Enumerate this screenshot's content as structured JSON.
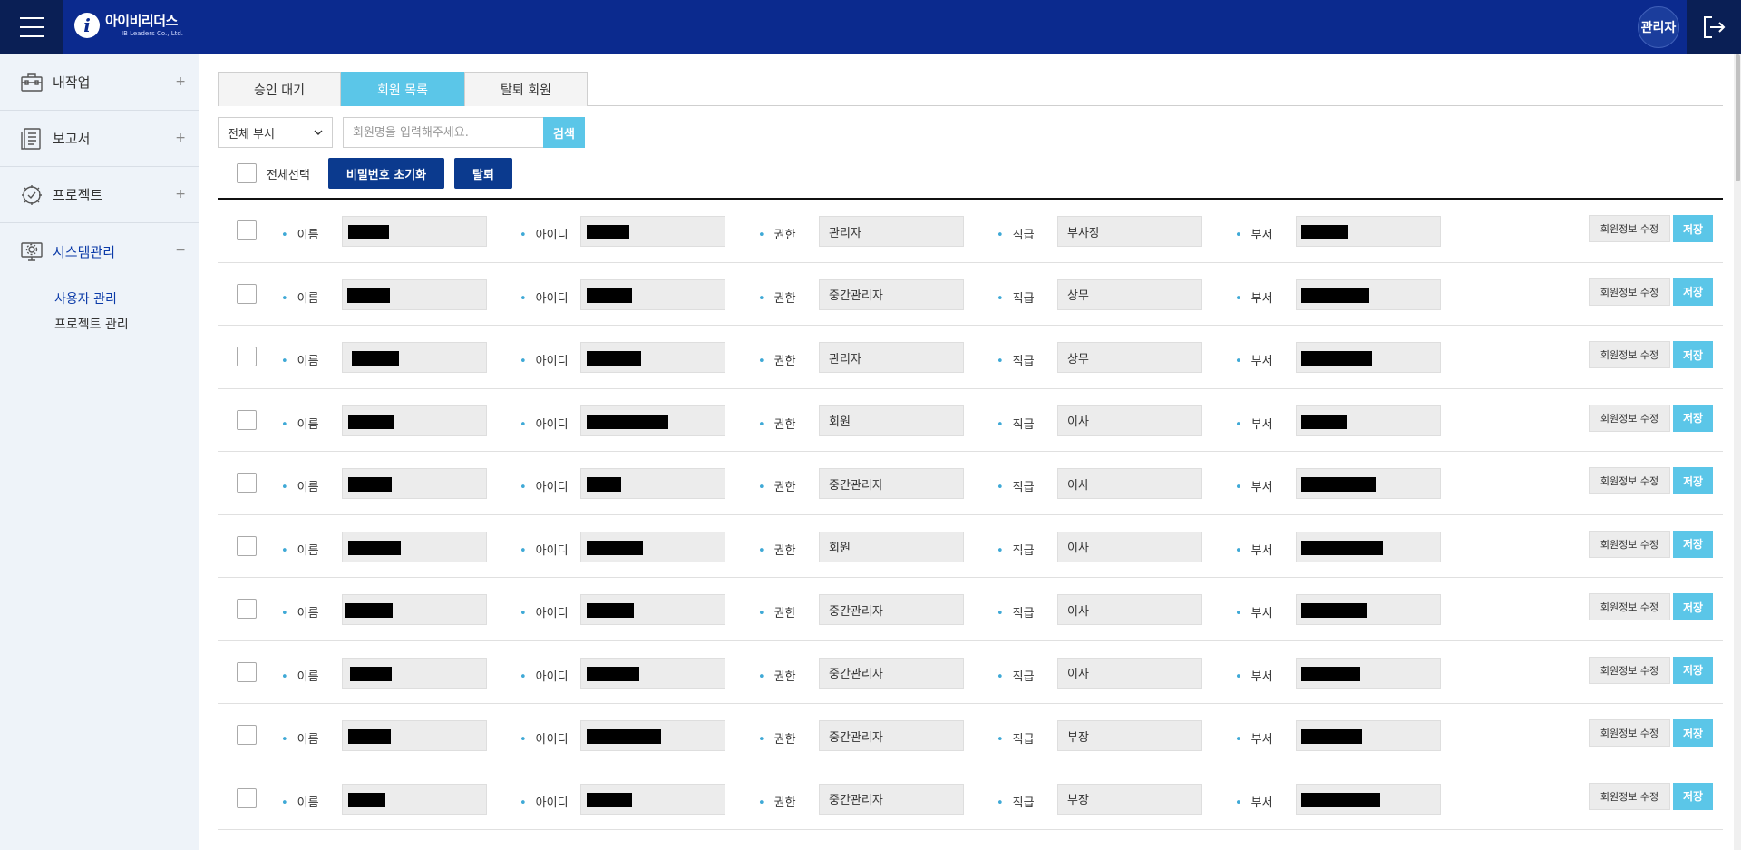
{
  "header": {
    "logo_title": "아이비리더스",
    "logo_sub": "IB Leaders Co., Ltd.",
    "user_badge": "관리자"
  },
  "sidebar": {
    "items": [
      {
        "label": "내작업",
        "toggle": "+",
        "icon": "briefcase-icon"
      },
      {
        "label": "보고서",
        "toggle": "+",
        "icon": "report-icon"
      },
      {
        "label": "프로젝트",
        "toggle": "+",
        "icon": "gear-check-icon"
      },
      {
        "label": "시스템관리",
        "toggle": "−",
        "icon": "monitor-settings-icon"
      }
    ],
    "sub_items": [
      {
        "label": "사용자 관리"
      },
      {
        "label": "프로젝트 관리"
      }
    ]
  },
  "tabs": [
    {
      "label": "승인 대기"
    },
    {
      "label": "회원 목록"
    },
    {
      "label": "탈퇴 회원"
    }
  ],
  "filter": {
    "department_select": "전체 부서",
    "search_placeholder": "회원명을 입력해주세요.",
    "search_button": "검색"
  },
  "actions": {
    "select_all": "전체선택",
    "reset_password": "비밀번호 초기화",
    "withdraw": "탈퇴"
  },
  "field_labels": {
    "name": "이름",
    "id": "아이디",
    "role": "권한",
    "position": "직급",
    "department": "부서",
    "edit": "회원정보 수정",
    "save": "저장"
  },
  "members": [
    {
      "role": "관리자",
      "position": "부사장"
    },
    {
      "role": "중간관리자",
      "position": "상무"
    },
    {
      "role": "관리자",
      "position": "상무"
    },
    {
      "role": "회원",
      "position": "이사"
    },
    {
      "role": "중간관리자",
      "position": "이사"
    },
    {
      "role": "회원",
      "position": "이사"
    },
    {
      "role": "중간관리자",
      "position": "이사"
    },
    {
      "role": "중간관리자",
      "position": "이사"
    },
    {
      "role": "중간관리자",
      "position": "부장"
    },
    {
      "role": "중간관리자",
      "position": "부장"
    }
  ],
  "colors": {
    "header_bg": "#0b2a8e",
    "accent": "#5bc6e8",
    "dark_button": "#0b3a8e"
  }
}
